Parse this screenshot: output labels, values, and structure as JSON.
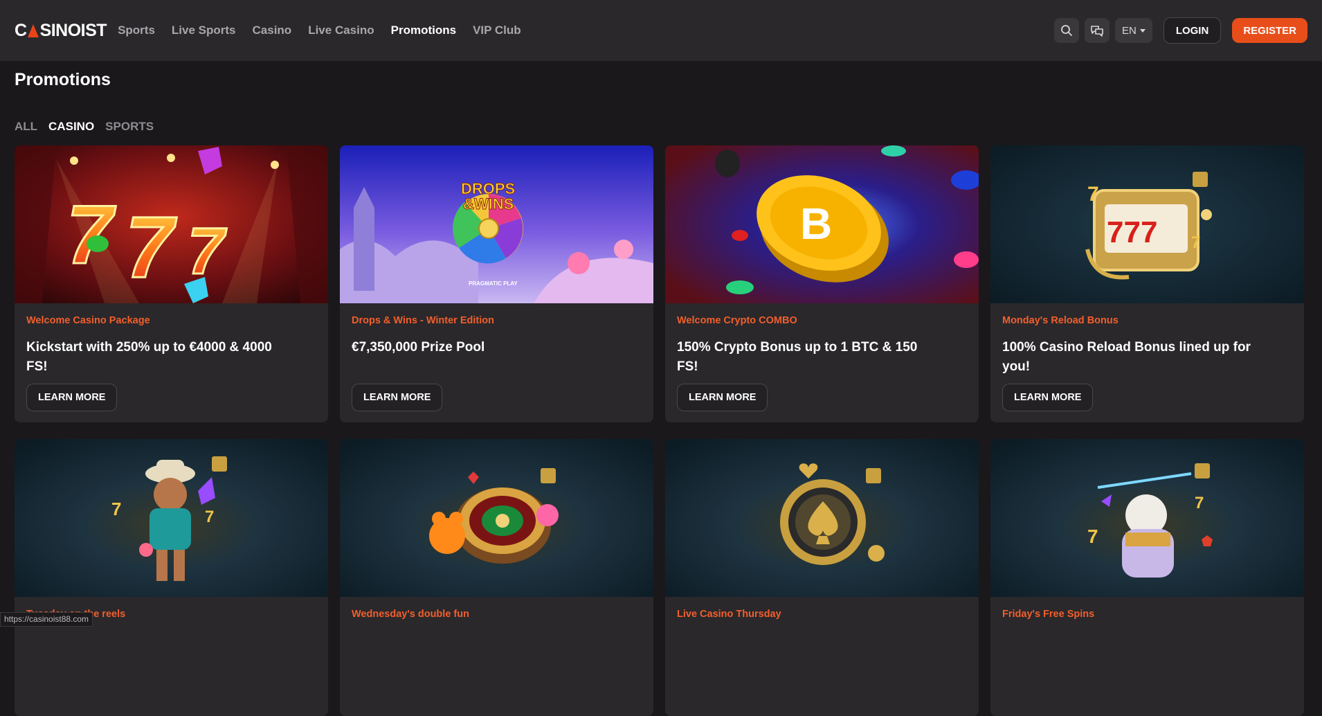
{
  "header": {
    "logo": {
      "left": "C",
      "right": "SINOIST"
    },
    "nav": [
      "Sports",
      "Live Sports",
      "Casino",
      "Live Casino",
      "Promotions",
      "VIP Club"
    ],
    "active_nav": "Promotions",
    "language": "EN",
    "login_label": "LOGIN",
    "register_label": "REGISTER"
  },
  "page": {
    "title": "Promotions",
    "filters": [
      "ALL",
      "CASINO",
      "SPORTS"
    ],
    "active_filter": "CASINO"
  },
  "promotions": [
    {
      "category": "Welcome Casino Package",
      "title": "Kickstart with 250% up to €4000 & 4000 FS!",
      "button": "LEARN MORE"
    },
    {
      "category": "Drops & Wins - Winter Edition",
      "title": "€7,350,000 Prize Pool",
      "button": "LEARN MORE",
      "banner_text": {
        "line1": "DROPS",
        "line2": "&WINS",
        "provider": "PRAGMATIC PLAY"
      }
    },
    {
      "category": "Welcome Crypto COMBO",
      "title": "150% Crypto Bonus up to 1 BTC & 150 FS!",
      "button": "LEARN MORE"
    },
    {
      "category": "Monday's Reload Bonus",
      "title": "100% Casino Reload Bonus lined up for you!",
      "button": "LEARN MORE"
    },
    {
      "category": "Tuesday on the reels",
      "title": "",
      "button": ""
    },
    {
      "category": "Wednesday's double fun",
      "title": "",
      "button": ""
    },
    {
      "category": "Live Casino Thursday",
      "title": "",
      "button": ""
    },
    {
      "category": "Friday's Free Spins",
      "title": "",
      "button": ""
    }
  ],
  "status_url": "https://casinoist88.com",
  "colors": {
    "accent": "#e84e1a",
    "category": "#f25f2c",
    "header_bg": "#2a282b",
    "page_bg": "#1a181b"
  }
}
